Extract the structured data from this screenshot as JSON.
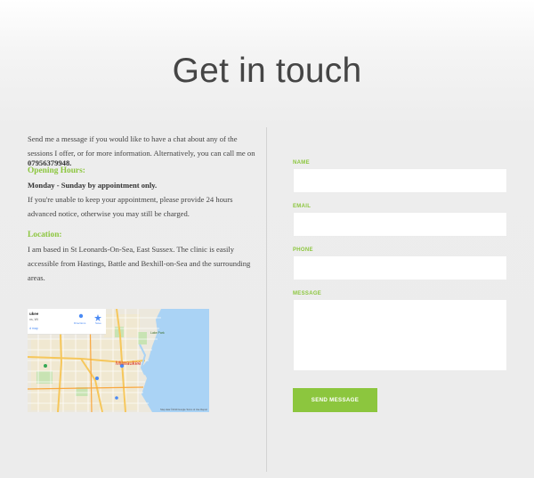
{
  "page": {
    "title": "Get in touch"
  },
  "contact": {
    "intro": "Send me a message if you would like to have a chat about any of the sessions I offer, or for more information. Alternatively, you can call me on",
    "phone": "07956379948.",
    "hours_heading": "Opening Hours:",
    "hours_days": "Monday - Sunday by appointment only.",
    "hours_note": "If you're unable to keep your appointment, please provide 24 hours advanced notice, otherwise you may still be charged.",
    "location_heading": "Location:",
    "location_text": "I am based in St Leonards-On-Sea, East Sussex. The clinic is easily accessible from Hastings, Battle and Bexhill-on-Sea and the surrounding areas."
  },
  "map": {
    "city_label": "Milwaukee",
    "lake_label": "Lake Park",
    "card_title": "ukee",
    "card_sub": "ns, WI",
    "card_link": "d map",
    "directions_label": "Directions",
    "save_label": "Save",
    "attribution": "Map data ©2019 Google   Terms of Use   Report"
  },
  "form": {
    "name_label": "NAME",
    "email_label": "EMAIL",
    "phone_label": "PHONE",
    "message_label": "MESSAGE",
    "submit_label": "SEND MESSAGE"
  },
  "colors": {
    "accent": "#8cc63e",
    "heading": "#454545",
    "background": "#ececec"
  }
}
